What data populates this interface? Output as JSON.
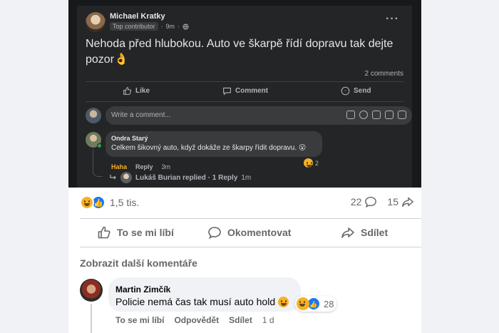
{
  "embedded_post": {
    "author": "Michael Kratky",
    "badge": "Top contributor",
    "time": "9m",
    "more": "···",
    "text": "Nehoda před hlubokou. Auto ve škarpě řídí dopravu tak dejte pozor👌",
    "comment_count": "2 comments",
    "actions": {
      "like": "Like",
      "comment": "Comment",
      "send": "Send"
    },
    "composer_placeholder": "Write a comment...",
    "comment": {
      "author": "Ondra Starý",
      "text": "Celkem šikovný auto, když dokáže ze škarpy řídit dopravu. 😮",
      "reaction_label": "Haha",
      "reply_label": "Reply",
      "time": "3m",
      "reaction_count": "2"
    },
    "replies_line": "Lukáš Burian replied · 1 Reply",
    "replies_time": "1m"
  },
  "post_stats": {
    "reactions_count": "1,5 tis.",
    "comments_count": "22",
    "shares_count": "15"
  },
  "post_actions": {
    "like": "To se mi líbí",
    "comment": "Okomentovat",
    "share": "Sdílet"
  },
  "more_comments": "Zobrazit další komentáře",
  "comment": {
    "author": "Martin Zimčík",
    "text": "Policie nemá čas tak musí auto hold",
    "reactions_count": "28",
    "actions": {
      "like": "To se mi líbí",
      "reply": "Odpovědět",
      "share": "Sdílet"
    },
    "time": "1 d"
  },
  "colors": {
    "dark_bg": "#18191a",
    "dark_card": "#242526",
    "haha": "#f7b125",
    "accent_blue": "#1877f2"
  },
  "icons": [
    "globe-icon",
    "thumbs-up-icon",
    "comment-icon",
    "messenger-icon",
    "sticker-icon",
    "emoji-icon",
    "camera-icon",
    "gif-icon",
    "reply-arrow-icon",
    "share-arrow-icon",
    "haha-emoji-icon",
    "like-reaction-icon"
  ]
}
